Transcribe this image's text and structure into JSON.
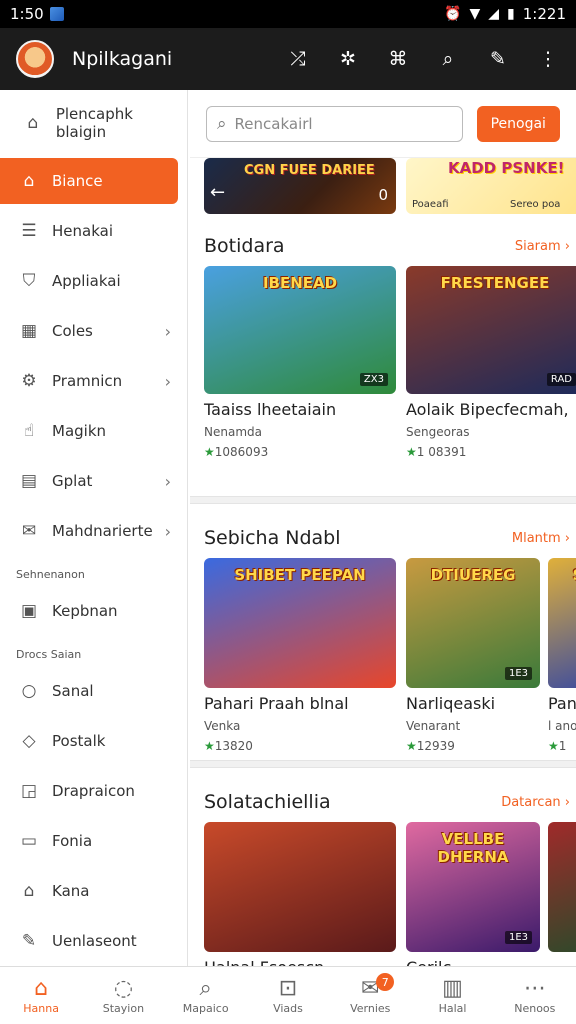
{
  "status_bar": {
    "time": "1:50",
    "right_time": "1:221"
  },
  "app_bar": {
    "title": "Npilkagani",
    "icons": [
      "shuffle-icon",
      "puzzle-icon",
      "gamepad-icon",
      "search-icon",
      "edit-icon",
      "more-vertical-icon"
    ]
  },
  "search": {
    "placeholder": "Rencakairl",
    "button": "Penogai"
  },
  "sidebar": {
    "header": "Plencaphk blaigin",
    "items": [
      {
        "label": "Biance",
        "icon": "home-icon",
        "active": true,
        "chevron": false
      },
      {
        "label": "Henakai",
        "icon": "list-icon",
        "active": false,
        "chevron": false
      },
      {
        "label": "Appliakai",
        "icon": "shield-icon",
        "active": false,
        "chevron": false
      },
      {
        "label": "Coles",
        "icon": "grid-icon",
        "active": false,
        "chevron": true
      },
      {
        "label": "Pramnicn",
        "icon": "gear-icon",
        "active": false,
        "chevron": true
      },
      {
        "label": "Magikn",
        "icon": "hand-icon",
        "active": false,
        "chevron": false
      },
      {
        "label": "Gplat",
        "icon": "calendar-icon",
        "active": false,
        "chevron": true
      },
      {
        "label": "Mahdnarierte",
        "icon": "mail-icon",
        "active": false,
        "chevron": true
      }
    ],
    "section1": "Sehnenanon",
    "items2": [
      {
        "label": "Kepbnan",
        "icon": "image-icon"
      }
    ],
    "section2": "Drocs Saian",
    "items3": [
      {
        "label": "Sanal",
        "icon": "circle-icon"
      },
      {
        "label": "Postalk",
        "icon": "tag-icon"
      },
      {
        "label": "Drapraicon",
        "icon": "crop-icon"
      },
      {
        "label": "Fonia",
        "icon": "file-icon"
      },
      {
        "label": "Kana",
        "icon": "house-icon"
      },
      {
        "label": "Uenlaseont",
        "icon": "doc-edit-icon"
      }
    ]
  },
  "banners": [
    {
      "title": "CGN FUEE DARIEE",
      "count": "0"
    },
    {
      "title": "KADD PSNKE!",
      "left": "Poaeafi",
      "right": "Sereo poa"
    }
  ],
  "sections": [
    {
      "title": "Botidara",
      "more": "Siaram",
      "cards": [
        {
          "title": "Taaiss lheetaiain",
          "sub": "Nenamda",
          "rating": "1086093",
          "logo": "IBENEAD",
          "badge": "ZX3",
          "c1": "#2f8a3a",
          "c2": "#4aa0e0"
        },
        {
          "title": "Aolaik Bipecfecmah,",
          "sub": "Sengeoras",
          "rating": "1 08391",
          "logo": "FRESTENGEE",
          "badge": "RAD",
          "c1": "#1d2a5a",
          "c2": "#8a3a2a"
        }
      ]
    },
    {
      "title": "Sebicha Ndabl",
      "more": "Mlantm",
      "cards": [
        {
          "title": "Pahari Praah blnal",
          "sub": "Venka",
          "rating": "13820",
          "logo": "SHIBET PEEPAN",
          "badge": "",
          "c1": "#e8462a",
          "c2": "#3a6ae0"
        },
        {
          "title": "Narliqeaski",
          "sub": "Venarant",
          "rating": "12939",
          "logo": "DTIUEREG",
          "badge": "1E3",
          "c1": "#3a7a3a",
          "c2": "#c89a40"
        },
        {
          "title": "Pan",
          "sub": "l ano",
          "rating": "1",
          "logo": "S",
          "badge": "",
          "c1": "#3a4aa0",
          "c2": "#e0b03a"
        }
      ]
    },
    {
      "title": "Solatachiellia",
      "more": "Datarcan",
      "cards": [
        {
          "title": "Halnal Fsoescn",
          "sub": "",
          "rating": "",
          "logo": "",
          "badge": "",
          "c1": "#5a1a1a",
          "c2": "#c84a2a"
        },
        {
          "title": "Cerilc",
          "sub": "",
          "rating": "",
          "logo": "VELLBE DHERNA",
          "badge": "1E3",
          "c1": "#3a1a6a",
          "c2": "#e06aa0"
        },
        {
          "title": "",
          "sub": "",
          "rating": "",
          "logo": "",
          "badge": "",
          "c1": "#2a4a2a",
          "c2": "#a02a2a"
        }
      ]
    }
  ],
  "bottom_nav": [
    {
      "label": "Hanna",
      "icon": "home-icon",
      "active": true,
      "badge": ""
    },
    {
      "label": "Stayion",
      "icon": "chat-icon",
      "active": false,
      "badge": ""
    },
    {
      "label": "Mapaico",
      "icon": "search-icon",
      "active": false,
      "badge": ""
    },
    {
      "label": "Viads",
      "icon": "bag-icon",
      "active": false,
      "badge": ""
    },
    {
      "label": "Vernies",
      "icon": "message-icon",
      "active": false,
      "badge": "7"
    },
    {
      "label": "Halal",
      "icon": "store-icon",
      "active": false,
      "badge": ""
    },
    {
      "label": "Nenoos",
      "icon": "more-horizontal-icon",
      "active": false,
      "badge": ""
    }
  ],
  "colors": {
    "accent": "#f26122",
    "appbar": "#1c1c1c",
    "rating": "#2a9a3a"
  }
}
